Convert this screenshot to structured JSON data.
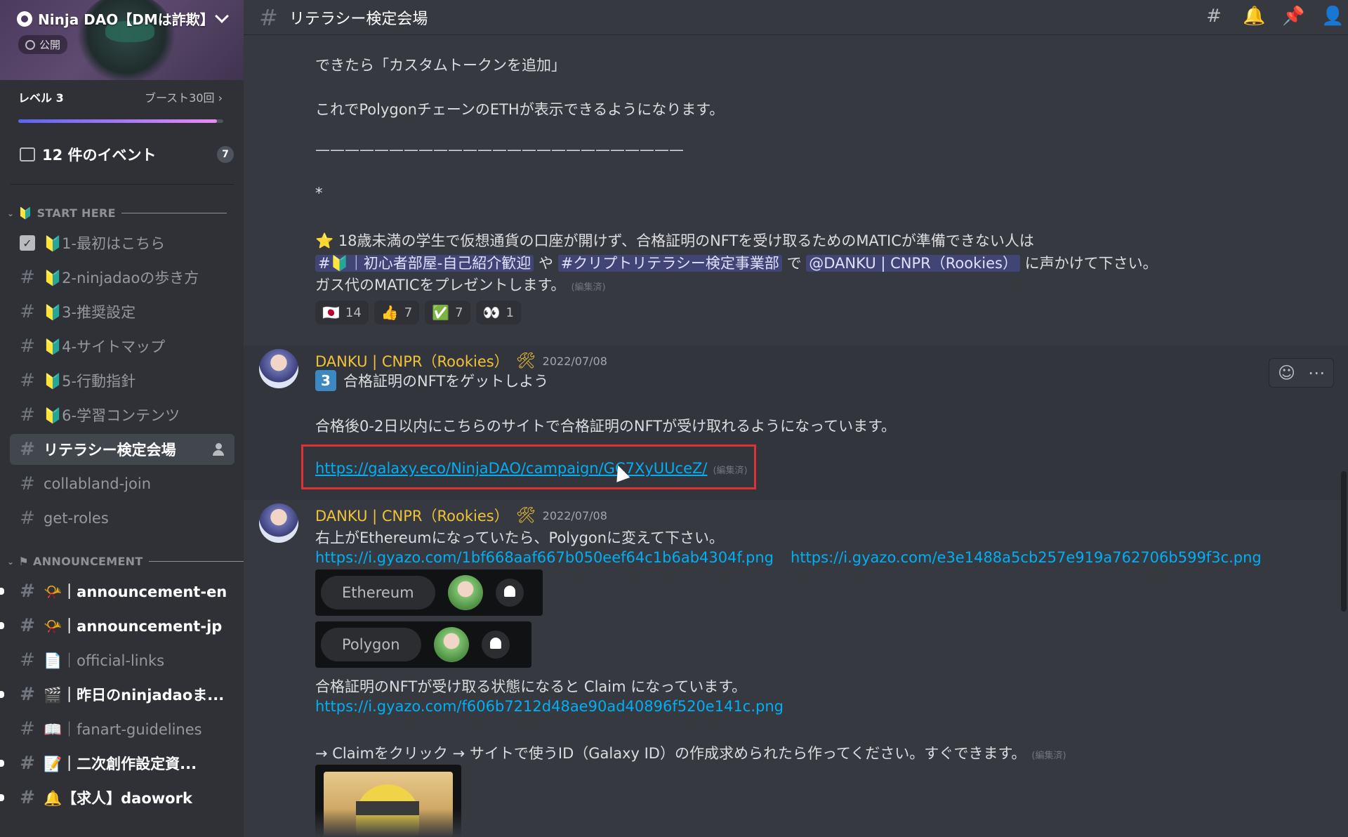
{
  "server": {
    "name": "Ninja DAO【DMは詐欺】",
    "visibility": "公開",
    "level": "レベル 3",
    "boost": "ブースト30回 ›",
    "boost_progress": 0.97
  },
  "events": {
    "label": "12 件のイベント",
    "count": "7"
  },
  "categories": [
    {
      "label": "START HERE"
    },
    {
      "label": "ANNOUNCEMENT"
    }
  ],
  "channels": [
    {
      "label": "🔰1-最初はこちら"
    },
    {
      "label": "🔰2-ninjadaoの歩き方"
    },
    {
      "label": "🔰3-推奨設定"
    },
    {
      "label": "🔰4-サイトマップ"
    },
    {
      "label": "🔰5-行動指針"
    },
    {
      "label": "🔰6-学習コンテンツ"
    },
    {
      "label": "リテラシー検定会場"
    },
    {
      "label": "collabland-join"
    },
    {
      "label": "get-roles"
    },
    {
      "label": "📯｜announcement-en"
    },
    {
      "label": "📯｜announcement-jp"
    },
    {
      "label": "📄｜official-links"
    },
    {
      "label": "🎬｜昨日のninjadaoま..."
    },
    {
      "label": "📖｜fanart-guidelines"
    },
    {
      "label": "📝｜二次創作設定資..."
    },
    {
      "label": "🔔【求人】daowork"
    }
  ],
  "topbar": {
    "channel": "リテラシー検定会場"
  },
  "messages": {
    "line1": "できたら「カスタムトークンを追加」",
    "line2": "これでPolygonチェーンのETHが表示できるようになります。",
    "line3": "—————————————————————————",
    "line4": "*",
    "line5": "⭐ 18歳未満の学生で仮想通貨の口座が開けず、合格証明のNFTを受け取るためのMATICが準備できない人は",
    "mention1": "#🔰｜初心者部屋-自己紹介歓迎",
    "ya": "や",
    "mention2": "#クリプトリテラシー検定事業部",
    "de": "で",
    "mention3": "@DANKU | CNPR（Rookies）",
    "tail": "に声かけて下さい。",
    "line7": "ガス代のMATICをプレゼントします。",
    "edited": "(編集済)",
    "reactions": [
      {
        "emoji": "🇯🇵",
        "count": "14"
      },
      {
        "emoji": "👍",
        "count": "7"
      },
      {
        "emoji": "✅",
        "count": "7"
      },
      {
        "emoji": "👀",
        "count": "1"
      }
    ],
    "msg2": {
      "author": "DANKU | CNPR（Rookies）",
      "time": "2022/07/08",
      "step": "3",
      "heading": "合格証明のNFTをゲットしよう",
      "body": "合格後0-2日以内にこちらのサイトで合格証明のNFTが受け取れるようになっています。",
      "link": "https://galaxy.eco/NinjaDAO/campaign/GC7XyUUceZ/"
    },
    "msg3": {
      "author": "DANKU | CNPR（Rookies）",
      "time": "2022/07/08",
      "body": "右上がEthereumになっていたら、Polygonに変えて下さい。",
      "link1": "https://i.gyazo.com/1bf668aaf667b050eef64c1b6ab4304f.png",
      "link2": "https://i.gyazo.com/e3e1488a5cb257e919a762706b599f3c.png",
      "embed1": "Ethereum",
      "embed2": "Polygon",
      "body2": "合格証明のNFTが受け取る状態になると Claim になっています。",
      "link3": "https://i.gyazo.com/f606b7212d48ae90ad40896f520e141c.png",
      "body3": "→ Claimをクリック → サイトで使うID（Galaxy ID）の作成求められたら作ってください。すぐできます。"
    }
  }
}
